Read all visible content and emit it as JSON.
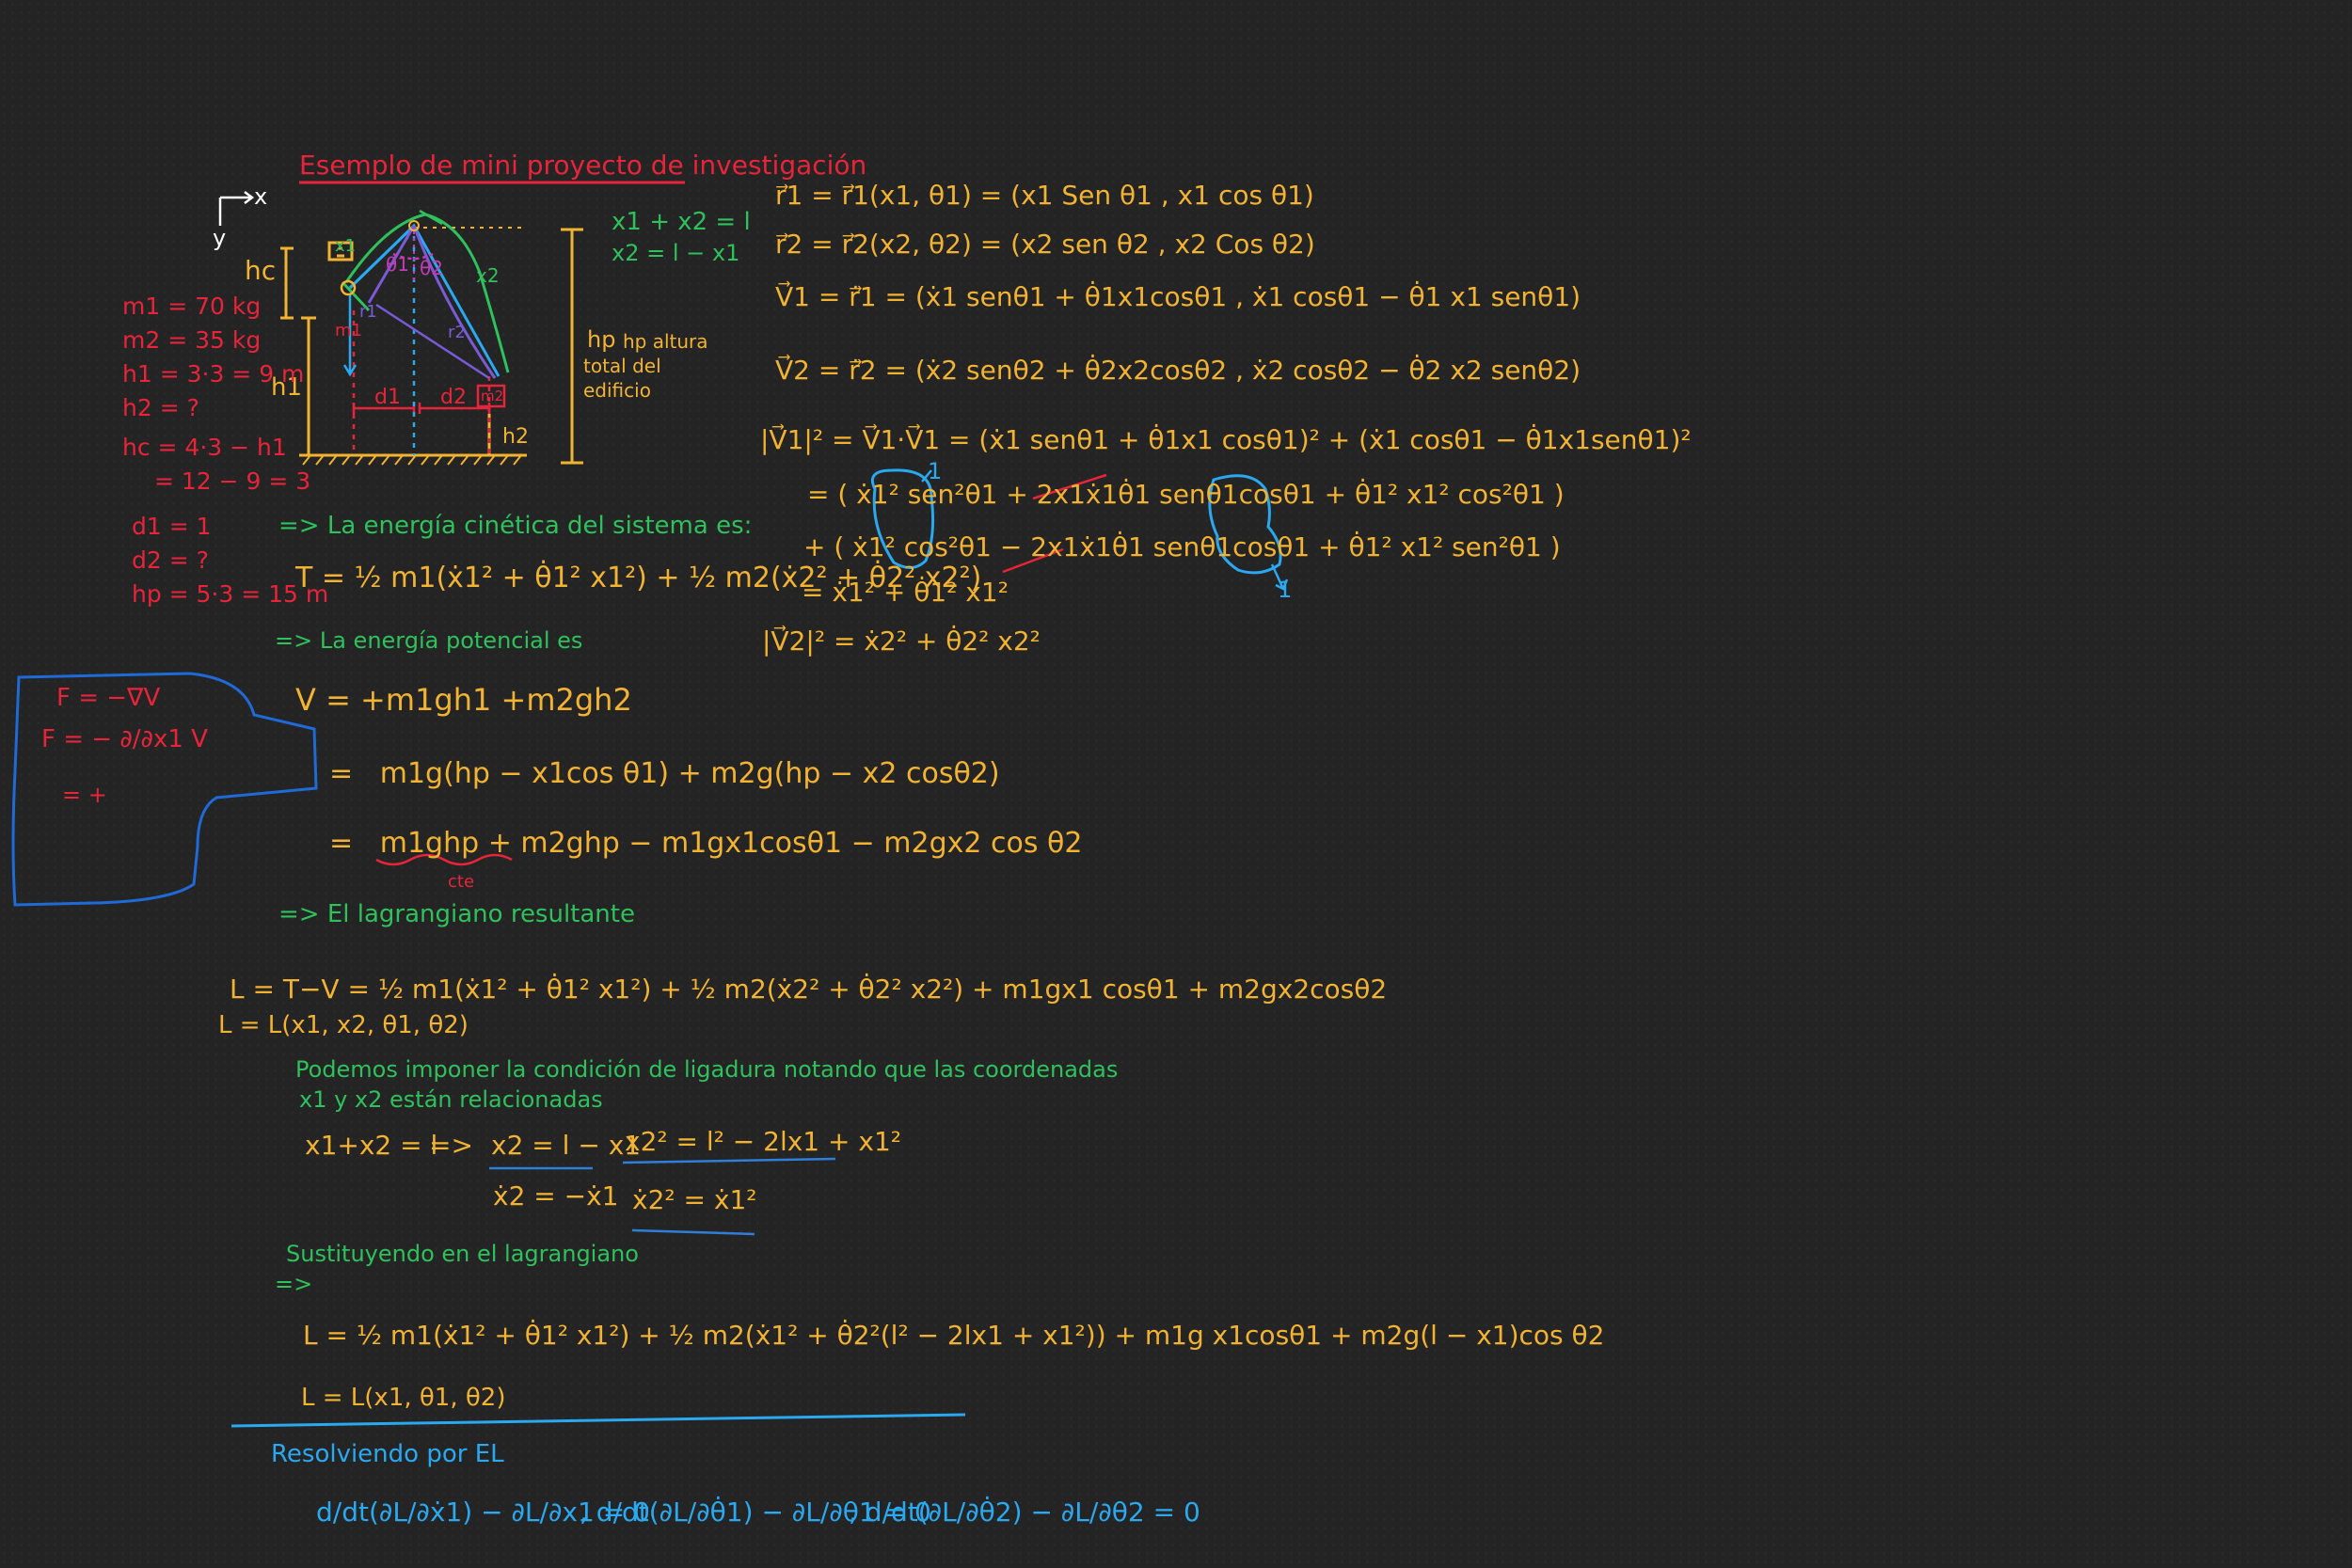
{
  "title": "Esemplo de mini proyecto de investigación",
  "diagram": {
    "axis_x": "x",
    "axis_y": "y",
    "h_c": "hc",
    "h_1": "h1",
    "h_2": "h2",
    "h_p": "hp",
    "altura_lines": [
      "hp altura",
      "total del",
      "edificio"
    ],
    "d1": "d1",
    "d2": "d2",
    "m1": "m1",
    "m2": "m2",
    "theta1": "θ1",
    "theta2": "θ2",
    "x1": "x1",
    "x2": "x2",
    "r1": "r1",
    "r2": "r2",
    "constraint1": "x1 + x2 = l",
    "constraint2": "x2 = l − x1"
  },
  "givens": [
    "m1 = 70 kg",
    "m2 = 35 kg",
    "h1 = 3·3 = 9 m",
    "h2 = ?",
    "hc = 4·3 − h1",
    "= 12 − 9 = 3",
    "d1 = 1",
    "d2 = ?",
    "hp = 5·3 = 15 m"
  ],
  "kinetic_heading": "=> La energía cinética del sistema es:",
  "kinetic_eq": "T = ½ m1(ẋ1² + θ̇1² x1²) + ½ m2(ẋ2² + θ̇2² x2²)",
  "potential_heading": "=> La energía potencial es",
  "potential_eq1": "V = +m1gh1  +m2gh2",
  "potential_eq2": "=   m1g(hp − x1cos θ1) + m2g(hp − x2 cosθ2)",
  "potential_eq3": "=   m1ghp + m2ghp − m1gx1cosθ1 − m2gx2 cos θ2",
  "cte": "cte",
  "force_box": [
    "F = −∇V",
    "F = − ∂/∂x1 V",
    "= +"
  ],
  "lagrangian_heading": "=> El lagrangiano resultante",
  "lagrangian_eq": "L = T−V = ½ m1(ẋ1² + θ̇1² x1²) + ½ m2(ẋ2² + θ̇2² x2²) + m1gx1 cosθ1 + m2gx2cosθ2",
  "lagrangian_vars": "L = L(x1, x2, θ1, θ2)",
  "constraint_text1": "Podemos imponer la condición de ligadura notando que las coordenadas",
  "constraint_text2": "x1 y x2 están relacionadas",
  "constraint_eq1": "x1+x2 = l",
  "arrow": "=>",
  "constraint_eq2": "x2 = l − x1",
  "constraint_eq3": "x2² = l² − 2lx1 + x1²",
  "constraint_eq4": "ẋ2 = −ẋ1",
  "constraint_eq5": "ẋ2² = ẋ1²",
  "subst_heading1": "Sustituyendo en el lagrangiano",
  "subst_heading2": "=>",
  "subst_eq": "L = ½ m1(ẋ1² + θ̇1² x1²) + ½ m2(ẋ1² + θ̇2²(l² − 2lx1 + x1²)) + m1g x1cosθ1 + m2g(l − x1)cos θ2",
  "subst_vars": "L = L(x1, θ1, θ2)",
  "el_heading": "Resolviendo por EL",
  "el_eqs": [
    "d/dt(∂L/∂ẋ1) − ∂L/∂x1 = 0",
    ",  d/dt(∂L/∂θ̇1) − ∂L/∂θ1 = 0",
    ",  d/dt(∂L/∂θ̇2) − ∂L/∂θ2 = 0"
  ],
  "right_eqs": [
    "r⃗1 = r⃗1(x1, θ1) = (x1 Sen θ1 ,  x1 cos θ1)",
    "r⃗2 = r⃗2(x2, θ2) = (x2 sen θ2 ,  x2 Cos θ2)",
    "V⃗1 = r⃗̇1 = (ẋ1 senθ1 + θ̇1x1cosθ1 ,  ẋ1 cosθ1 − θ̇1 x1 senθ1)",
    "V⃗2 = r⃗̇2 = (ẋ2 senθ2 + θ̇2x2cosθ2 ,  ẋ2 cosθ2 − θ̇2 x2 senθ2)",
    "|V⃗1|² = V⃗1·V⃗1 = (ẋ1 senθ1 + θ̇1x1 cosθ1)² + (ẋ1 cosθ1 − θ̇1x1senθ1)²",
    "= ( ẋ1² sen²θ1 + 2x1ẋ1θ̇1 senθ1cosθ1 + θ̇1² x1² cos²θ1 )",
    "+ ( ẋ1² cos²θ1 − 2x1ẋ1θ̇1 senθ1cosθ1 + θ̇1² x1² sen²θ1 )",
    "= ẋ1² + θ̇1² x1²",
    "|V⃗2|² = ẋ2² + θ̇2² x2²"
  ],
  "one_top": "1",
  "one_bottom": "1",
  "colors": {
    "background": "#242424",
    "yellow": "#f2b332",
    "green": "#2ec15c",
    "red": "#e8243a",
    "blue": "#2aa9f0",
    "purple": "#7a5bd6",
    "magenta": "#c43ab8"
  }
}
